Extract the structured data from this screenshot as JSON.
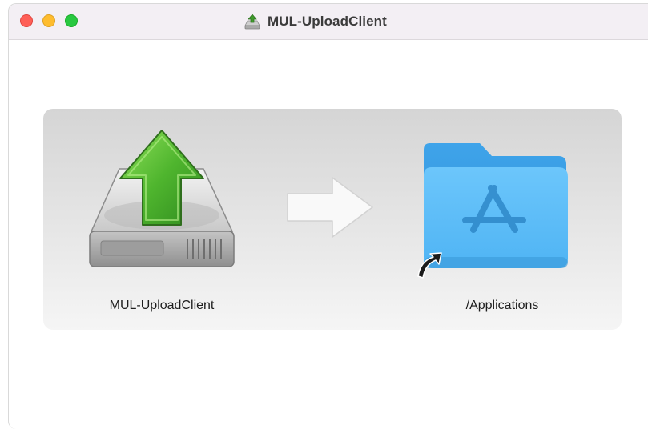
{
  "window": {
    "title": "MUL-UploadClient",
    "controls": {
      "close_color": "#fe5f57",
      "minimize_color": "#febc2e",
      "maximize_color": "#28c840"
    }
  },
  "installer": {
    "source": {
      "label": "MUL-UploadClient",
      "icon": "upload-drive-icon"
    },
    "arrow_icon": "right-arrow-icon",
    "target": {
      "label": "/Applications",
      "icon": "applications-folder-icon",
      "alias_badge": "alias-arrow-icon"
    }
  }
}
